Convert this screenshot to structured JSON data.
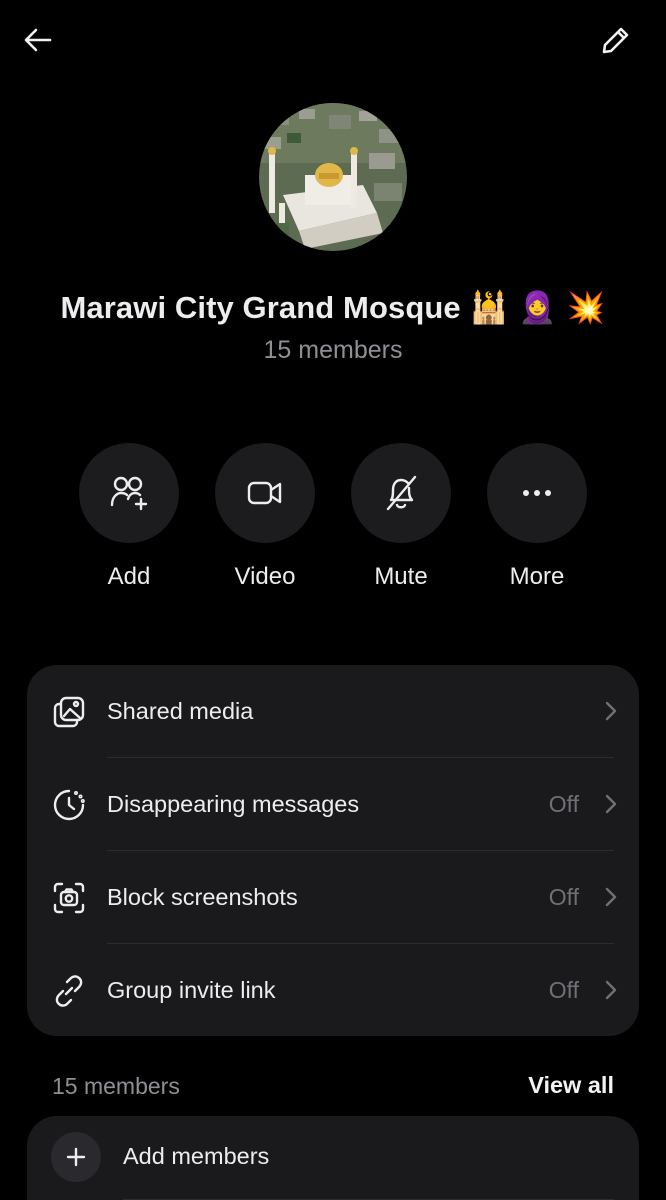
{
  "header": {
    "back_icon": "arrow-left-icon",
    "edit_icon": "pencil-icon"
  },
  "group": {
    "name": "Marawi City Grand Mosque",
    "name_emojis": "🕌 🧕 💥",
    "members_label": "15 members"
  },
  "actions": [
    {
      "label": "Add",
      "icon": "add-people-icon"
    },
    {
      "label": "Video",
      "icon": "video-camera-icon"
    },
    {
      "label": "Mute",
      "icon": "bell-off-icon"
    },
    {
      "label": "More",
      "icon": "more-dots-icon"
    }
  ],
  "settings": [
    {
      "label": "Shared media",
      "value": "",
      "icon": "image-gallery-icon"
    },
    {
      "label": "Disappearing messages",
      "value": "Off",
      "icon": "timer-icon"
    },
    {
      "label": "Block screenshots",
      "value": "Off",
      "icon": "screenshot-camera-icon"
    },
    {
      "label": "Group invite link",
      "value": "Off",
      "icon": "link-icon"
    }
  ],
  "members": {
    "heading": "15 members",
    "view_all": "View all",
    "add_label": "Add members"
  },
  "colors": {
    "background": "#000000",
    "card": "#1a1a1d",
    "action_circle": "#1c1c1f",
    "text": "#ededef",
    "muted": "#8f8f95"
  }
}
